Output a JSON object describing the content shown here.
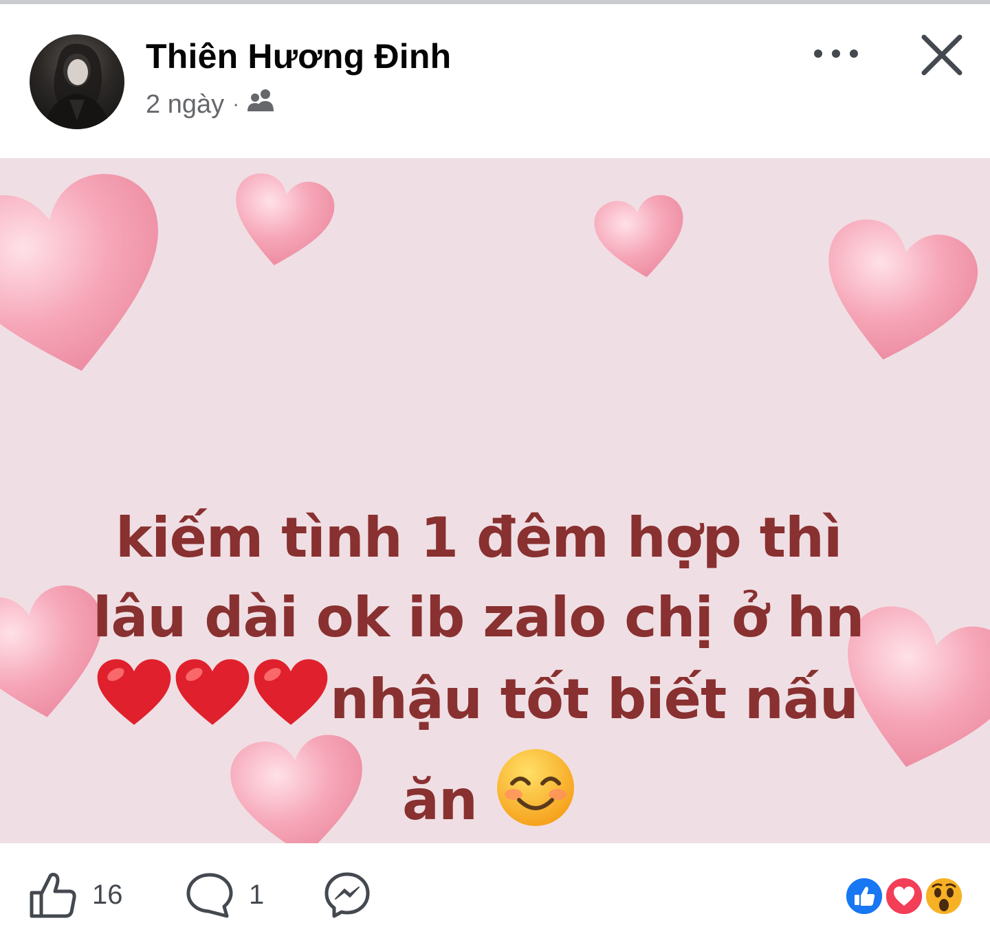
{
  "post": {
    "author": "Thiên Hương Đinh",
    "time": "2 ngày",
    "separator": "·",
    "audience_icon": "friends-icon",
    "text_lines": [
      "kiếm tình 1 đêm hợp thì",
      "lâu dài ok ib zalo chị ở hn",
      "nhậu tốt biết nấu",
      "ăn"
    ],
    "text_color": "#893030",
    "background_color": "#efdfe4"
  },
  "actions": {
    "like_count": "16",
    "comment_count": "1"
  },
  "reactions": [
    "like",
    "love",
    "wow"
  ],
  "colors": {
    "like_blue": "#1877f2",
    "love_red": "#f33e58",
    "wow_yellow": "#f7b125"
  }
}
